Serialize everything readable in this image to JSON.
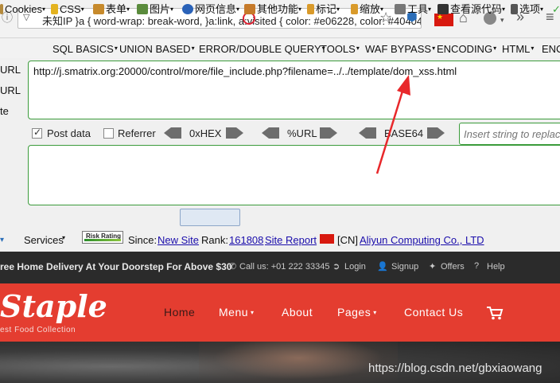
{
  "browser": {
    "url_text": "未知IP    }a { word-wrap: break-word, }a:link, a:visited { color: #e06228, color: #404042",
    "icons": [
      "dropdown-arrow",
      "blocked-icon",
      "star-icon",
      "flag-cn",
      "home-icon",
      "addon-icon",
      "overflow-chevrons",
      "hamburger-menu"
    ]
  },
  "hackbar": {
    "menu": [
      {
        "label": "SQL BASICS"
      },
      {
        "label": "UNION BASED"
      },
      {
        "label": "ERROR/DOUBLE QUERY"
      },
      {
        "label": "TOOLS"
      },
      {
        "label": "WAF BYPASS"
      },
      {
        "label": "ENCODING"
      },
      {
        "label": "HTML"
      },
      {
        "label": "ENC"
      }
    ],
    "left_labels": [
      "URL",
      "URL",
      "te"
    ],
    "url_value": "http://j.smatrix.org:20000/control/more/file_include.php?filename=../../template/dom_xss.html",
    "options": {
      "post_data": "Post data",
      "referrer": "Referrer",
      "hex": "0xHEX",
      "url": "%URL",
      "base64": "BASE64",
      "post_checked": true,
      "referrer_checked": false
    },
    "insert_placeholder": "Insert string to replace"
  },
  "toolbar2": {
    "items": [
      {
        "label": "Cookies"
      },
      {
        "label": "CSS"
      },
      {
        "label": "表单"
      },
      {
        "label": "图片"
      },
      {
        "label": "网页信息"
      },
      {
        "label": "其他功能"
      },
      {
        "label": "标记"
      },
      {
        "label": "缩放"
      },
      {
        "label": "工具"
      },
      {
        "label": "查看源代码"
      },
      {
        "label": "选项"
      }
    ]
  },
  "toolbar3": {
    "services": "Services",
    "risk_rating": "Risk Rating",
    "since_label": "Since:",
    "since_link": "New Site",
    "rank_label": "Rank:",
    "rank_link": "161808",
    "site_report": "Site Report",
    "country": "[CN]",
    "owner_link": "Aliyun Computing Co., LTD"
  },
  "website": {
    "promo": "ree Home Delivery At Your Doorstep For Above $30",
    "call": "Call us: +01 222 33345",
    "login": "Login",
    "signup": "Signup",
    "offers": "Offers",
    "help": "Help",
    "logo": "Staple",
    "tagline": "est Food Collection",
    "nav": [
      {
        "label": "Home",
        "has_dropdown": false
      },
      {
        "label": "Menu",
        "has_dropdown": true
      },
      {
        "label": "About",
        "has_dropdown": false
      },
      {
        "label": "Pages",
        "has_dropdown": true
      },
      {
        "label": "Contact Us",
        "has_dropdown": false
      }
    ],
    "colors": {
      "nav_bg": "#e43d30",
      "topbar_bg": "#2b2b2b",
      "active_nav": "#3a1a17"
    }
  },
  "watermark": "https://blog.csdn.net/gbxiaowang"
}
